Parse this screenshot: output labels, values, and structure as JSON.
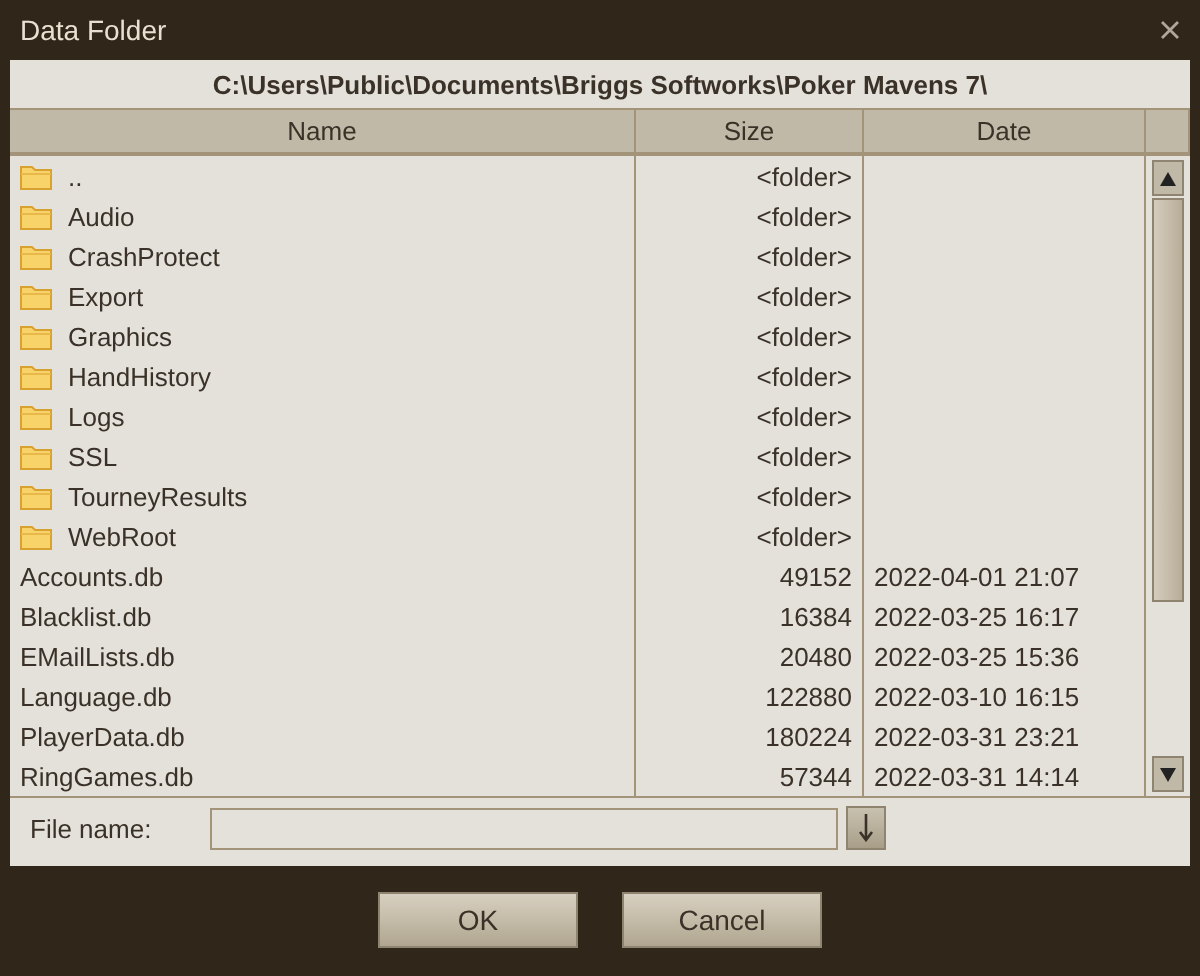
{
  "window": {
    "title": "Data Folder"
  },
  "path": "C:\\Users\\Public\\Documents\\Briggs Softworks\\Poker Mavens 7\\",
  "table": {
    "columns": [
      "Name",
      "Size",
      "Date"
    ],
    "rows": [
      {
        "kind": "folder",
        "name": "..",
        "size": "<folder>",
        "date": ""
      },
      {
        "kind": "folder",
        "name": "Audio",
        "size": "<folder>",
        "date": ""
      },
      {
        "kind": "folder",
        "name": "CrashProtect",
        "size": "<folder>",
        "date": ""
      },
      {
        "kind": "folder",
        "name": "Export",
        "size": "<folder>",
        "date": ""
      },
      {
        "kind": "folder",
        "name": "Graphics",
        "size": "<folder>",
        "date": ""
      },
      {
        "kind": "folder",
        "name": "HandHistory",
        "size": "<folder>",
        "date": ""
      },
      {
        "kind": "folder",
        "name": "Logs",
        "size": "<folder>",
        "date": ""
      },
      {
        "kind": "folder",
        "name": "SSL",
        "size": "<folder>",
        "date": ""
      },
      {
        "kind": "folder",
        "name": "TourneyResults",
        "size": "<folder>",
        "date": ""
      },
      {
        "kind": "folder",
        "name": "WebRoot",
        "size": "<folder>",
        "date": ""
      },
      {
        "kind": "file",
        "name": "Accounts.db",
        "size": "49152",
        "date": "2022-04-01 21:07"
      },
      {
        "kind": "file",
        "name": "Blacklist.db",
        "size": "16384",
        "date": "2022-03-25 16:17"
      },
      {
        "kind": "file",
        "name": "EMailLists.db",
        "size": "20480",
        "date": "2022-03-25 15:36"
      },
      {
        "kind": "file",
        "name": "Language.db",
        "size": "122880",
        "date": "2022-03-10 16:15"
      },
      {
        "kind": "file",
        "name": "PlayerData.db",
        "size": "180224",
        "date": "2022-03-31 23:21"
      },
      {
        "kind": "file",
        "name": "RingGames.db",
        "size": "57344",
        "date": "2022-03-31 14:14"
      }
    ]
  },
  "file_name": {
    "label": "File name:"
  },
  "buttons": [
    "OK",
    "Cancel"
  ]
}
